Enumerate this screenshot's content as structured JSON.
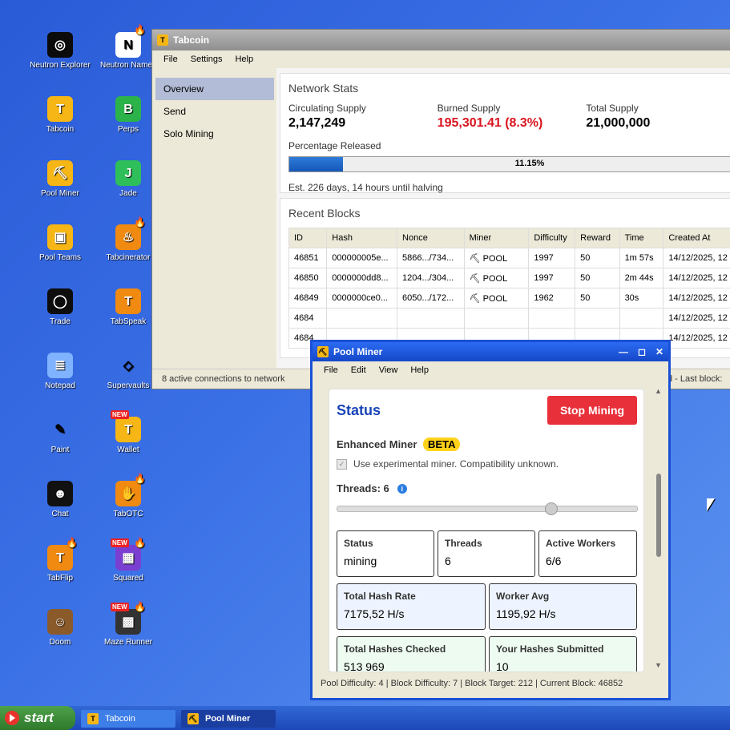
{
  "desktop_icons": [
    {
      "label": "Neutron Explorer",
      "icon": "globe-icon",
      "bg": "#0b0b0b"
    },
    {
      "label": "Neutron Names",
      "icon": "letter-n-icon",
      "bg": "#ffffff"
    },
    {
      "label": "Tabcoin",
      "icon": "tabcoin-icon",
      "bg": "#f6b615"
    },
    {
      "label": "Perps",
      "icon": "perps-icon",
      "bg": "#2bb34a"
    },
    {
      "label": "Pool Miner",
      "icon": "pickaxe-icon",
      "bg": "#f6b615"
    },
    {
      "label": "Jade",
      "icon": "jade-icon",
      "bg": "#2fbf5a"
    },
    {
      "label": "Pool Teams",
      "icon": "pool-teams-icon",
      "bg": "#f6b615"
    },
    {
      "label": "Tabcinerator",
      "icon": "flame-icon",
      "bg": "#f08a10"
    },
    {
      "label": "Trade",
      "icon": "trade-icon",
      "bg": "#0d0d0d"
    },
    {
      "label": "TabSpeak",
      "icon": "tabspeak-icon",
      "bg": "#f08a10"
    },
    {
      "label": "Notepad",
      "icon": "notepad-icon",
      "bg": "#7fb2ff"
    },
    {
      "label": "Supervaults",
      "icon": "diamond-icon",
      "bg": "transparent"
    },
    {
      "label": "Paint",
      "icon": "paint-icon",
      "bg": "transparent"
    },
    {
      "label": "Wallet",
      "icon": "wallet-icon",
      "bg": "#f6b615"
    },
    {
      "label": "Chat",
      "icon": "chat-icon",
      "bg": "#111"
    },
    {
      "label": "TabOTC",
      "icon": "handshake-icon",
      "bg": "#f08a10"
    },
    {
      "label": "TabFlip",
      "icon": "tabflip-icon",
      "bg": "#f08a10"
    },
    {
      "label": "Squared",
      "icon": "squared-icon",
      "bg": "#7a3fd1"
    },
    {
      "label": "Doom",
      "icon": "doom-icon",
      "bg": "#8b5a2b"
    },
    {
      "label": "Maze Runner",
      "icon": "maze-icon",
      "bg": "#333"
    }
  ],
  "new_badge": "NEW",
  "tabcoin": {
    "title": "Tabcoin",
    "menu": [
      "File",
      "Settings",
      "Help"
    ],
    "sidebar": [
      "Overview",
      "Send",
      "Solo Mining"
    ],
    "network": {
      "heading": "Network Stats",
      "circulating_label": "Circulating Supply",
      "circulating_value": "2,147,249",
      "burned_label": "Burned Supply",
      "burned_value": "195,301.41 (8.3%)",
      "total_label": "Total Supply",
      "total_value": "21,000,000",
      "released_label": "Percentage Released",
      "released_text": "11.15%",
      "released_fraction": 0.1115,
      "halving": "Est. 226 days, 14 hours until halving"
    },
    "blocks": {
      "heading": "Recent Blocks",
      "columns": [
        "ID",
        "Hash",
        "Nonce",
        "Miner",
        "Difficulty",
        "Reward",
        "Time",
        "Created At"
      ],
      "rows": [
        [
          "46851",
          "000000005e...",
          "5866.../734...",
          "POOL",
          "1997",
          "50",
          "1m 57s",
          "14/12/2025, 12"
        ],
        [
          "46850",
          "0000000dd8...",
          "1204.../304...",
          "POOL",
          "1997",
          "50",
          "2m 44s",
          "14/12/2025, 12"
        ],
        [
          "46849",
          "0000000ce0...",
          "6050.../172...",
          "POOL",
          "1962",
          "50",
          "30s",
          "14/12/2025, 12"
        ],
        [
          "4684",
          "",
          "",
          "",
          "",
          "",
          "",
          "14/12/2025, 12"
        ],
        [
          "4684",
          "",
          "",
          "",
          "",
          "",
          "",
          "14/12/2025, 12"
        ]
      ]
    },
    "statusbar": "8 active connections to network",
    "statusbar_right": "d - Last block:"
  },
  "pool": {
    "title": "Pool Miner",
    "menu": [
      "File",
      "Edit",
      "View",
      "Help"
    ],
    "status_heading": "Status",
    "stop_label": "Stop Mining",
    "enhanced_label": "Enhanced Miner",
    "beta_label": "BETA",
    "experimental_label": "Use experimental miner. Compatibility unknown.",
    "threads_label": "Threads: 6",
    "thread_fraction": 0.71,
    "cards": {
      "status": {
        "label": "Status",
        "value": "mining"
      },
      "threads": {
        "label": "Threads",
        "value": "6"
      },
      "workers": {
        "label": "Active Workers",
        "value": "6/6"
      },
      "hashrate": {
        "label": "Total Hash Rate",
        "value": "7175,52 H/s"
      },
      "worker_avg": {
        "label": "Worker Avg",
        "value": "1195,92 H/s"
      },
      "hashes_checked": {
        "label": "Total Hashes Checked",
        "value": "513 969"
      },
      "hashes_submitted": {
        "label": "Your Hashes Submitted",
        "value": "10"
      }
    },
    "statusbar": "Pool Difficulty: 4 | Block Difficulty: 7 | Block Target: 212 | Current Block: 46852",
    "win_minimize": "—",
    "win_maximize": "◻",
    "win_close": "✕"
  },
  "taskbar": {
    "start_label": "start",
    "tasks": [
      "Tabcoin",
      "Pool Miner"
    ]
  }
}
